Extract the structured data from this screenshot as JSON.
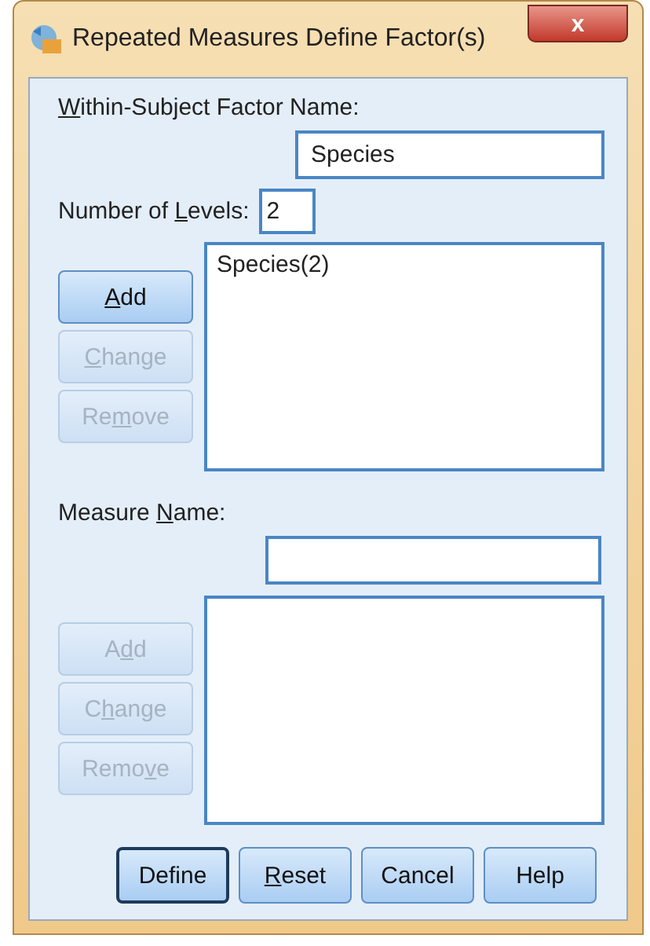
{
  "window": {
    "title": "Repeated Measures Define Factor(s)",
    "close": "x"
  },
  "factor_name": {
    "label": "Within-Subject Factor Name:",
    "value": "Species"
  },
  "levels": {
    "label": "Number of Levels:",
    "value": "2"
  },
  "factor_list": {
    "items": [
      "Species(2)"
    ]
  },
  "factor_buttons": [
    {
      "label": "Add",
      "disabled": false
    },
    {
      "label": "Change",
      "disabled": true
    },
    {
      "label": "Remove",
      "disabled": true
    }
  ],
  "measure_name": {
    "label": "Measure Name:"
  },
  "measure_buttons": [
    {
      "label": "Add",
      "disabled": true
    },
    {
      "label": "Change",
      "disabled": true
    },
    {
      "label": "Remove",
      "disabled": true
    }
  ],
  "footer_buttons": [
    {
      "label": "Define",
      "selected": true
    },
    {
      "label": "Reset",
      "selected": false
    },
    {
      "label": "Cancel",
      "selected": false
    },
    {
      "label": "Help",
      "selected": false
    }
  ]
}
